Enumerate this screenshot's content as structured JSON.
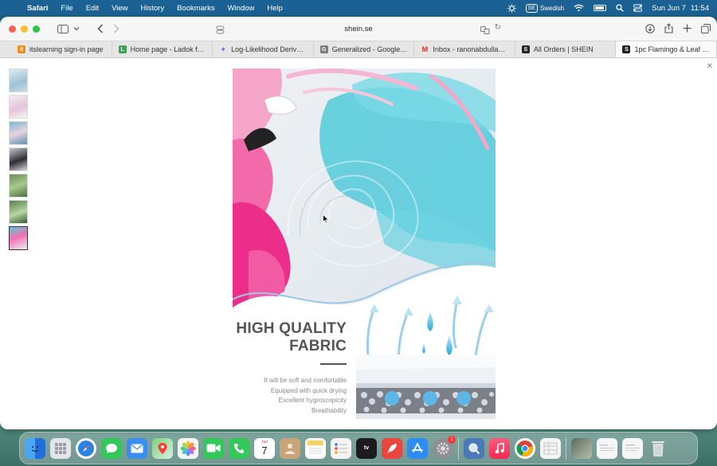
{
  "menubar": {
    "app_name": "Safari",
    "items": [
      "File",
      "Edit",
      "View",
      "History",
      "Bookmarks",
      "Window",
      "Help"
    ],
    "input_badge": "SE",
    "input_language": "Swedish",
    "date": "Sun Jun 7",
    "time": "11:54"
  },
  "browser": {
    "url": "shein.se",
    "tabs": [
      {
        "label": "itslearning sign-in page",
        "favicon": "it",
        "favicon_color": "#f08a1c"
      },
      {
        "label": "Home page - Ladok for...",
        "favicon": "L",
        "favicon_color": "#3aa655"
      },
      {
        "label": "Log-Likelihood Derivati...",
        "favicon": "✦",
        "favicon_color": "#4a7be8"
      },
      {
        "label": "Generalized - Google D...",
        "favicon": "G",
        "favicon_color": "#7a7a7a"
      },
      {
        "label": "Inbox - ranonabdullah8...",
        "favicon": "M",
        "favicon_color": "#d93025"
      },
      {
        "label": "All Orders | SHEIN",
        "favicon": "S",
        "favicon_color": "#222222"
      },
      {
        "label": "1pc Flamingo & Leaf P...",
        "favicon": "S",
        "favicon_color": "#222222"
      }
    ],
    "active_tab": 6
  },
  "gallery": {
    "thumbnail_count": 7,
    "selected_thumbnail": 7
  },
  "product": {
    "headline_line1": "HIGH QUALITY",
    "headline_line2": "FABRIC",
    "features": [
      "It will be soft and comfortable",
      "Equipped with quick drying",
      "Excellent hygroscopicity",
      "Breathability"
    ]
  },
  "dock": {
    "apps": [
      {
        "name": "Finder",
        "color": "#3b8ee8"
      },
      {
        "name": "Launchpad",
        "color": "#e4e4e8"
      },
      {
        "name": "Safari",
        "color": "#2a82e4"
      },
      {
        "name": "Messages",
        "color": "#34c759"
      },
      {
        "name": "Mail",
        "color": "#3a8ef0"
      },
      {
        "name": "Maps",
        "color": "#58b96a"
      },
      {
        "name": "Photos",
        "color": "#f5f5f5"
      },
      {
        "name": "FaceTime",
        "color": "#34c759"
      },
      {
        "name": "Phone",
        "color": "#34c759"
      },
      {
        "name": "Calendar",
        "color": "#ffffff"
      },
      {
        "name": "Contacts",
        "color": "#c8a47a"
      },
      {
        "name": "Notes",
        "color": "#f6d35b"
      },
      {
        "name": "Reminders",
        "color": "#f4f4f4"
      },
      {
        "name": "TV",
        "color": "#1c1c1e"
      },
      {
        "name": "Rocket",
        "color": "#e8453c"
      },
      {
        "name": "App Store",
        "color": "#2d8cf0"
      },
      {
        "name": "System Settings",
        "color": "#8e8e93"
      },
      {
        "name": "Preview",
        "color": "#4a78b8"
      },
      {
        "name": "Music",
        "color": "#fa3c5a"
      },
      {
        "name": "Chrome",
        "color": "#ffffff"
      },
      {
        "name": "Numbers",
        "color": "#f4f4f4"
      }
    ],
    "calendar_day": "Jun",
    "calendar_date": "7",
    "tv_label": "tv",
    "settings_badge": "1"
  }
}
